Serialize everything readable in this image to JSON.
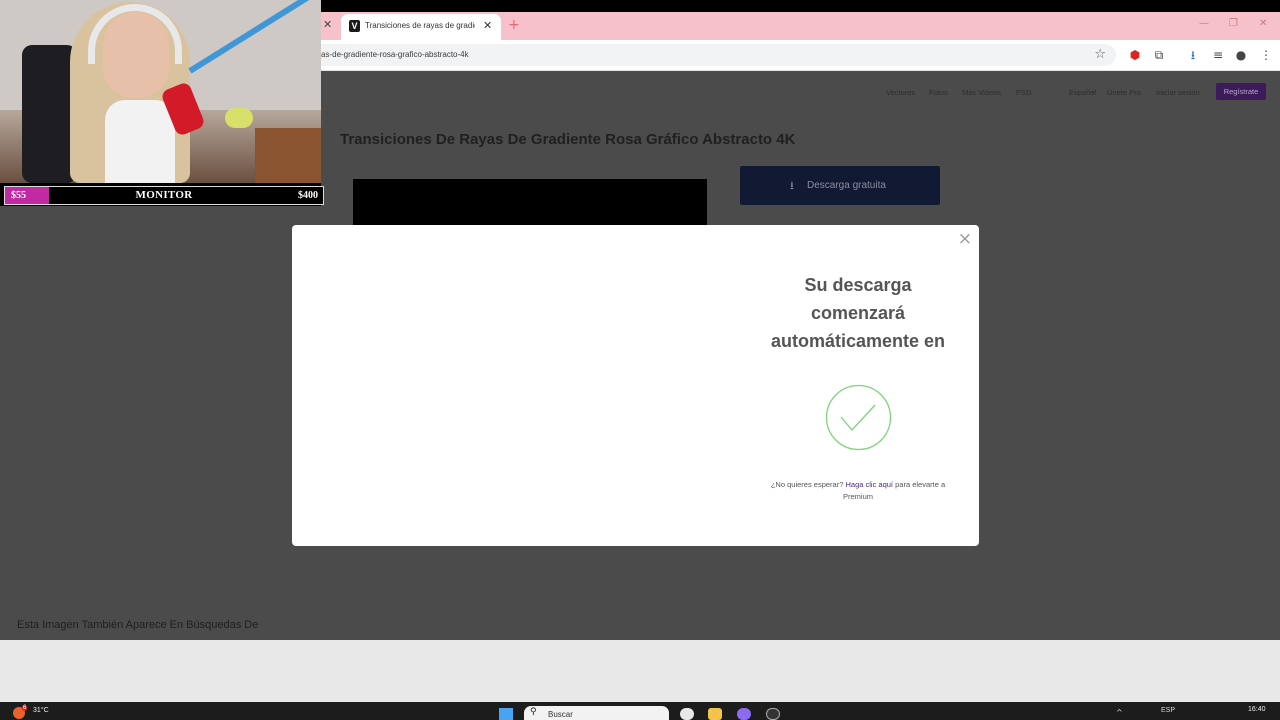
{
  "browser": {
    "tab_title": "Transiciones de rayas de gradie",
    "favicon_letter": "V",
    "url": "as-de-gradiente-rosa-grafico-abstracto-4k",
    "close_glyph": "✕",
    "new_tab_glyph": "+",
    "star_glyph": "☆",
    "minimize_glyph": "—",
    "restore_glyph": "❐",
    "window_close_glyph": "✕"
  },
  "site": {
    "nav": [
      "Vectores",
      "Fotos",
      "Más Videos",
      "PSD",
      "Español",
      "Únete Pro",
      "Iniciar sesión"
    ],
    "language_chevron": "⌄",
    "register_label": "Regístrate",
    "page_title": "Transiciones De Rayas De Gradiente Rosa Gráfico Abstracto 4K",
    "download_label": "Descarga gratuita",
    "download_icon": "⭳",
    "also_appears": "Esta Imagen También Aparece En Búsquedas De"
  },
  "modal": {
    "close_glyph": "×",
    "heading": "Su descarga comenzará automáticamente en",
    "no_wait_prefix": "¿No quieres esperar?",
    "no_wait_link": "Haga clic aquí",
    "no_wait_suffix": "para elevarte a Premium",
    "check_color": "#7fd37c"
  },
  "stream_overlay": {
    "goal_current": "$55",
    "goal_label": "MONITOR",
    "goal_target": "$400",
    "goal_fraction": 0.1375,
    "goal_color": "#c22aa4"
  },
  "taskbar": {
    "weather_temp": "31°C",
    "weather_badge": "6",
    "search_label": "Buscar",
    "search_icon": "⚲",
    "tray_up": "^",
    "language": "ESP",
    "time": "16:40"
  }
}
